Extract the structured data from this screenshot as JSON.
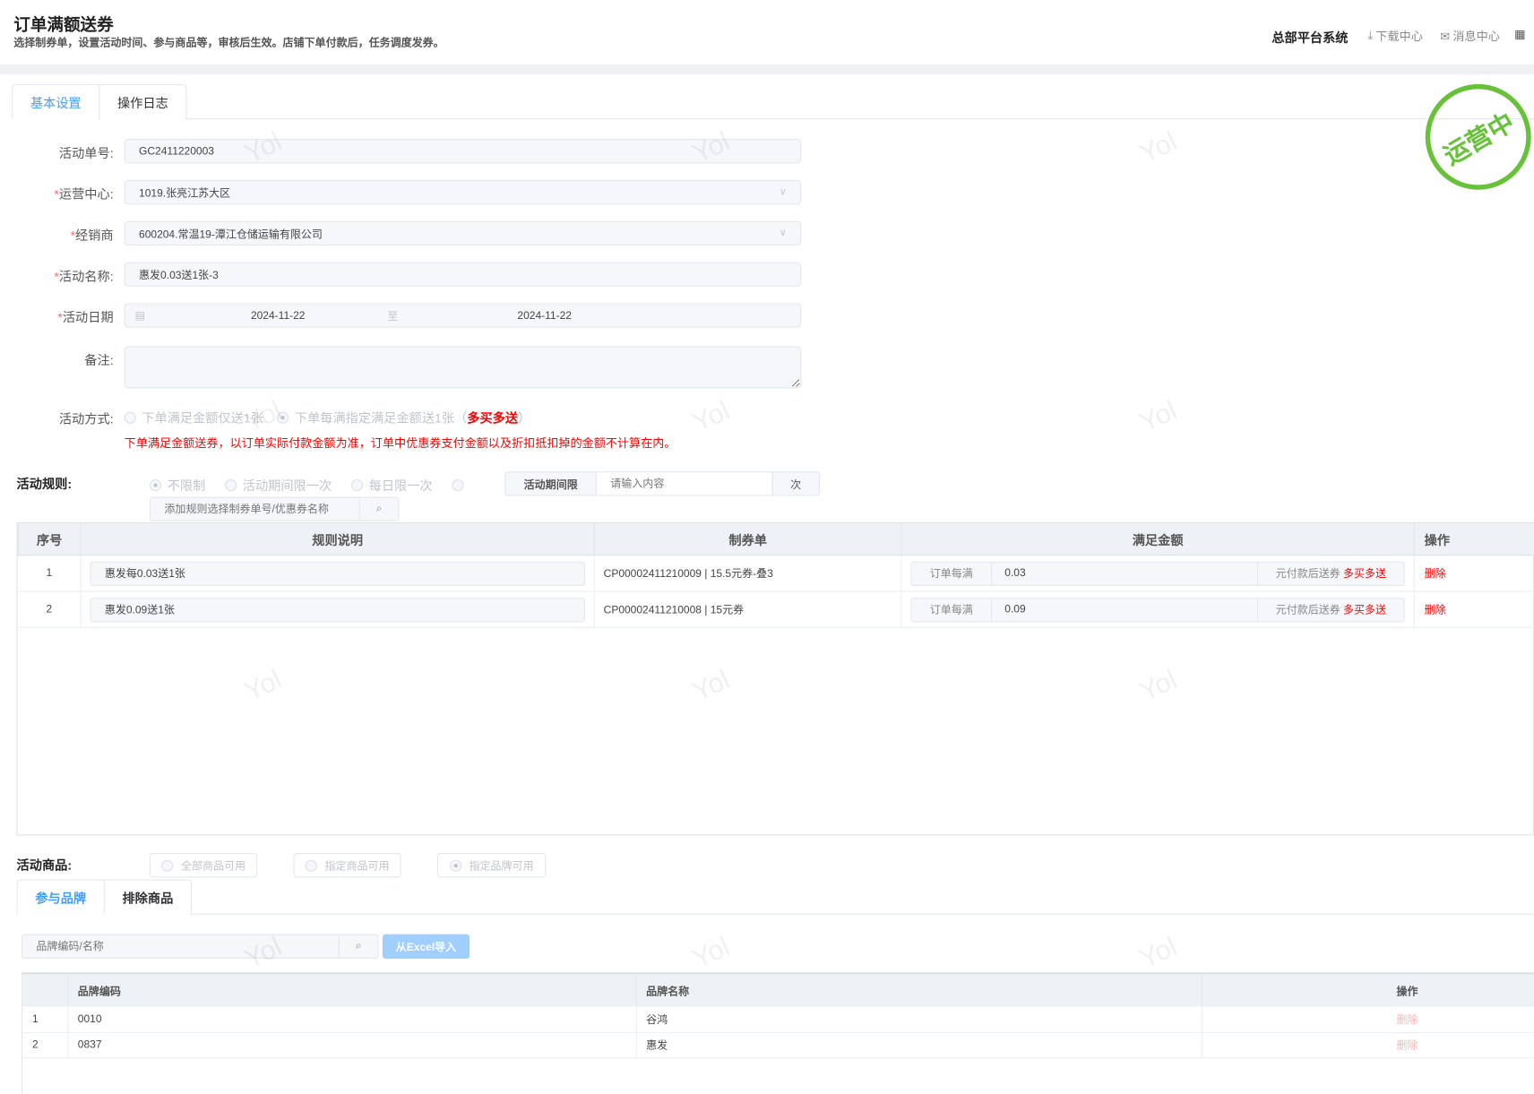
{
  "header": {
    "title": "订单满额送券",
    "subtitle": "选择制券单，设置活动时间、参与商品等，审核后生效。店铺下单付款后，任务调度发券。",
    "system": "总部平台系统",
    "download": "下载中心",
    "messages": "消息中心"
  },
  "tabs": [
    "基本设置",
    "操作日志"
  ],
  "status_stamp": "运营中",
  "form": {
    "activity_no": {
      "label": "活动单号:",
      "value": "GC2411220003"
    },
    "ops_center": {
      "label": "运营中心:",
      "value": "1019.张亮江苏大区"
    },
    "dealer": {
      "label": "经销商",
      "value": "600204.常温19-潭江仓储运输有限公司"
    },
    "activity_name": {
      "label": "活动名称:",
      "value": "惠发0.03送1张-3"
    },
    "activity_date": {
      "label": "活动日期",
      "start": "2024-11-22",
      "sep": "至",
      "end": "2024-11-22"
    },
    "remark": {
      "label": "备注:",
      "value": ""
    },
    "mode": {
      "label": "活动方式:",
      "option1": "下单满足金额仅送1张",
      "option2": "下单每满指定满足金额送1张（",
      "option2_red": "多买多送",
      "option2_end": "）",
      "selected": 2
    },
    "note": "下单满足金额送券，以订单实际付款金额为准，订单中优惠券支付金额以及折扣抵扣掉的金额不计算在内。"
  },
  "rules": {
    "label": "活动规则:",
    "options": [
      "不限制",
      "活动期间限一次",
      "每日限一次"
    ],
    "limit_prefix": "活动期间限",
    "limit_placeholder": "请输入内容",
    "limit_suffix": "次",
    "search_placeholder": "添加规则选择制券单号/优惠券名称",
    "columns": [
      "序号",
      "规则说明",
      "制券单",
      "满足金额",
      "操作"
    ],
    "rows": [
      {
        "no": "1",
        "desc": "惠发每0.03送1张",
        "coupon": "CP00002411210009 | 15.5元券-叠3",
        "prefix": "订单每满",
        "amount": "0.03",
        "suffix": "元付款后送券",
        "tag": "多买多送",
        "action": "删除"
      },
      {
        "no": "2",
        "desc": "惠发0.09送1张",
        "coupon": "CP00002411210008 | 15元券",
        "prefix": "订单每满",
        "amount": "0.09",
        "suffix": "元付款后送券",
        "tag": "多买多送",
        "action": "删除"
      }
    ]
  },
  "goods": {
    "label": "活动商品:",
    "options": [
      "全部商品可用",
      "指定商品可用",
      "指定品牌可用"
    ],
    "tabs": [
      "参与品牌",
      "排除商品"
    ],
    "search_placeholder": "品牌编码/名称",
    "import": "从Excel导入",
    "columns": [
      "",
      "品牌编码",
      "品牌名称",
      "操作"
    ],
    "rows": [
      {
        "no": "1",
        "code": "0010",
        "name": "谷鸿",
        "action": "删除"
      },
      {
        "no": "2",
        "code": "0837",
        "name": "惠发",
        "action": "删除"
      }
    ]
  },
  "watermark": "Yol"
}
